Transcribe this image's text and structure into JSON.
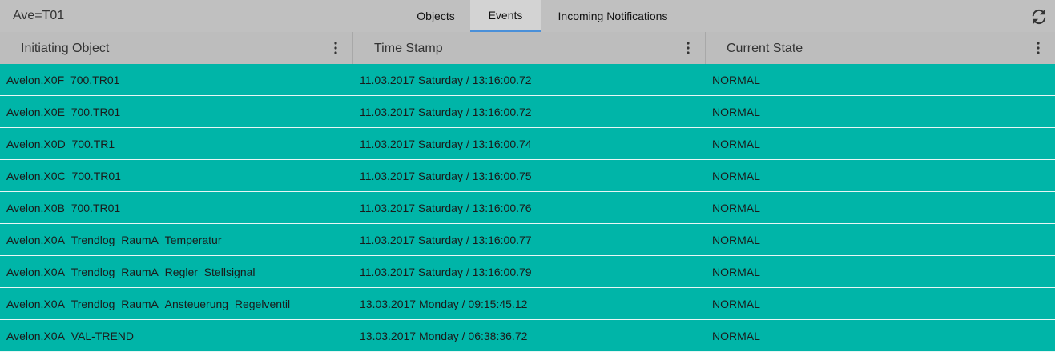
{
  "app": {
    "title": "Ave=T01"
  },
  "tabs": [
    {
      "label": "Objects"
    },
    {
      "label": "Events"
    },
    {
      "label": "Incoming Notifications"
    }
  ],
  "active_tab": "Events",
  "columns": [
    {
      "label": "Initiating Object"
    },
    {
      "label": "Time Stamp"
    },
    {
      "label": "Current State"
    }
  ],
  "rows": [
    {
      "object": "Avelon.X0F_700.TR01",
      "timestamp": "11.03.2017 Saturday / 13:16:00.72",
      "state": "NORMAL"
    },
    {
      "object": "Avelon.X0E_700.TR01",
      "timestamp": "11.03.2017 Saturday / 13:16:00.72",
      "state": "NORMAL"
    },
    {
      "object": "Avelon.X0D_700.TR1",
      "timestamp": "11.03.2017 Saturday / 13:16:00.74",
      "state": "NORMAL"
    },
    {
      "object": "Avelon.X0C_700.TR01",
      "timestamp": "11.03.2017 Saturday / 13:16:00.75",
      "state": "NORMAL"
    },
    {
      "object": "Avelon.X0B_700.TR01",
      "timestamp": "11.03.2017 Saturday / 13:16:00.76",
      "state": "NORMAL"
    },
    {
      "object": "Avelon.X0A_Trendlog_RaumA_Temperatur",
      "timestamp": "11.03.2017 Saturday / 13:16:00.77",
      "state": "NORMAL"
    },
    {
      "object": "Avelon.X0A_Trendlog_RaumA_Regler_Stellsignal",
      "timestamp": "11.03.2017 Saturday / 13:16:00.79",
      "state": "NORMAL"
    },
    {
      "object": "Avelon.X0A_Trendlog_RaumA_Ansteuerung_Regelventil",
      "timestamp": "13.03.2017 Monday / 09:15:45.12",
      "state": "NORMAL"
    },
    {
      "object": "Avelon.X0A_VAL-TREND",
      "timestamp": "13.03.2017 Monday / 06:38:36.72",
      "state": "NORMAL"
    }
  ],
  "colors": {
    "row_bg": "#00b5a8",
    "header_bg": "#bdbdbd",
    "tab_indicator": "#4a90d9"
  },
  "icons": {
    "refresh": "refresh-icon",
    "column_menu": "more-vert-icon"
  }
}
